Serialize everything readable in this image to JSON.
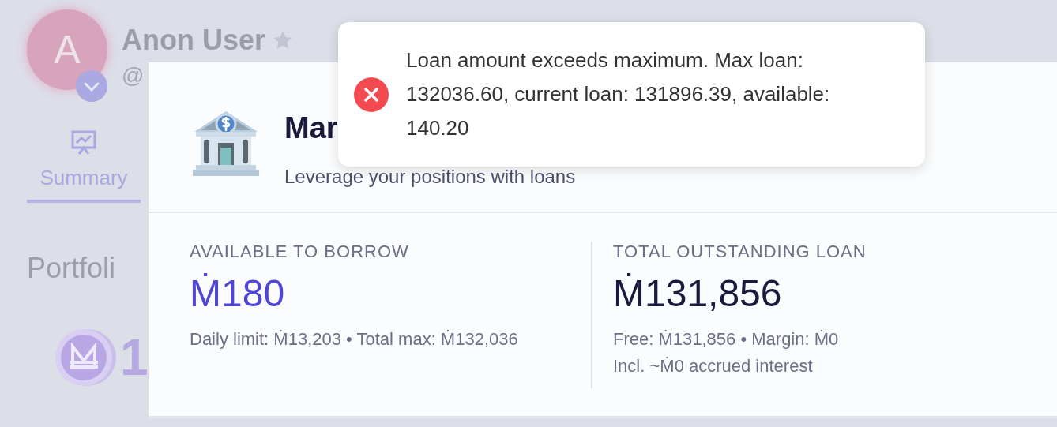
{
  "profile": {
    "avatar_letter": "A",
    "name": "Anon User",
    "handle": "@"
  },
  "tabs": [
    {
      "label": "Summary",
      "selected": true
    }
  ],
  "portfolio": {
    "title": "Portfoli",
    "balance": "1"
  },
  "modal": {
    "title": "Mar",
    "subtitle": "Leverage your positions with loans",
    "stats": [
      {
        "label": "AVAILABLE TO BORROW",
        "value": "Ṁ180",
        "kind": "accent",
        "notes": [
          "Daily limit: Ṁ13,203 • Total max: Ṁ132,036"
        ]
      },
      {
        "label": "TOTAL OUTSTANDING LOAN",
        "value": "Ṁ131,856",
        "kind": "plain",
        "notes": [
          "Free: Ṁ131,856 • Margin: Ṁ0",
          "Incl. ~Ṁ0 accrued interest"
        ]
      }
    ]
  },
  "toast": {
    "kind": "error",
    "message": "Loan amount exceeds maximum. Max loan: 132036.60, current loan: 131896.39, available: 140.20"
  }
}
